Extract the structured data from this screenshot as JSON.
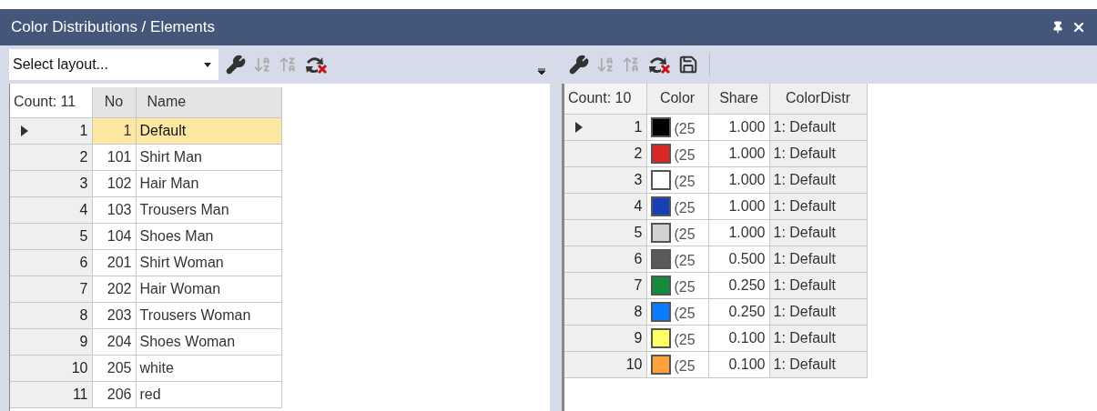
{
  "window": {
    "title": "Color Distributions / Elements"
  },
  "left_toolbar": {
    "layout_select": {
      "placeholder": "Select layout..."
    }
  },
  "elements_table": {
    "count_label": "Count: 11",
    "columns": [
      "No",
      "Name"
    ],
    "rows": [
      {
        "index": "1",
        "no": "1",
        "name": "Default",
        "selected": true
      },
      {
        "index": "2",
        "no": "101",
        "name": "Shirt Man",
        "selected": false
      },
      {
        "index": "3",
        "no": "102",
        "name": "Hair Man",
        "selected": false
      },
      {
        "index": "4",
        "no": "103",
        "name": "Trousers Man",
        "selected": false
      },
      {
        "index": "5",
        "no": "104",
        "name": "Shoes Man",
        "selected": false
      },
      {
        "index": "6",
        "no": "201",
        "name": "Shirt Woman",
        "selected": false
      },
      {
        "index": "7",
        "no": "202",
        "name": "Hair Woman",
        "selected": false
      },
      {
        "index": "8",
        "no": "203",
        "name": "Trousers Woman",
        "selected": false
      },
      {
        "index": "9",
        "no": "204",
        "name": "Shoes Woman",
        "selected": false
      },
      {
        "index": "10",
        "no": "205",
        "name": "white",
        "selected": false
      },
      {
        "index": "11",
        "no": "206",
        "name": "red",
        "selected": false
      }
    ]
  },
  "colors_table": {
    "count_label": "Count: 10",
    "columns": [
      "Color",
      "Share",
      "ColorDistr"
    ],
    "rows": [
      {
        "index": "1",
        "color": "#000000",
        "color_text": "(25",
        "share": "1.000",
        "distribution": "1: Default",
        "selected": true
      },
      {
        "index": "2",
        "color": "#dc2626",
        "color_text": "(25",
        "share": "1.000",
        "distribution": "1: Default",
        "selected": false
      },
      {
        "index": "3",
        "color": "#ffffff",
        "color_text": "(25",
        "share": "1.000",
        "distribution": "1: Default",
        "selected": false
      },
      {
        "index": "4",
        "color": "#1640b4",
        "color_text": "(25",
        "share": "1.000",
        "distribution": "1: Default",
        "selected": false
      },
      {
        "index": "5",
        "color": "#d2d2d2",
        "color_text": "(25",
        "share": "1.000",
        "distribution": "1: Default",
        "selected": false
      },
      {
        "index": "6",
        "color": "#5a5a5a",
        "color_text": "(25",
        "share": "0.500",
        "distribution": "1: Default",
        "selected": false
      },
      {
        "index": "7",
        "color": "#148c3c",
        "color_text": "(25",
        "share": "0.250",
        "distribution": "1: Default",
        "selected": false
      },
      {
        "index": "8",
        "color": "#0a7cff",
        "color_text": "(25",
        "share": "0.250",
        "distribution": "1: Default",
        "selected": false
      },
      {
        "index": "9",
        "color": "#ffff64",
        "color_text": "(25",
        "share": "0.100",
        "distribution": "1: Default",
        "selected": false
      },
      {
        "index": "10",
        "color": "#ffa03c",
        "color_text": "(25",
        "share": "0.100",
        "distribution": "1: Default",
        "selected": false
      }
    ]
  }
}
